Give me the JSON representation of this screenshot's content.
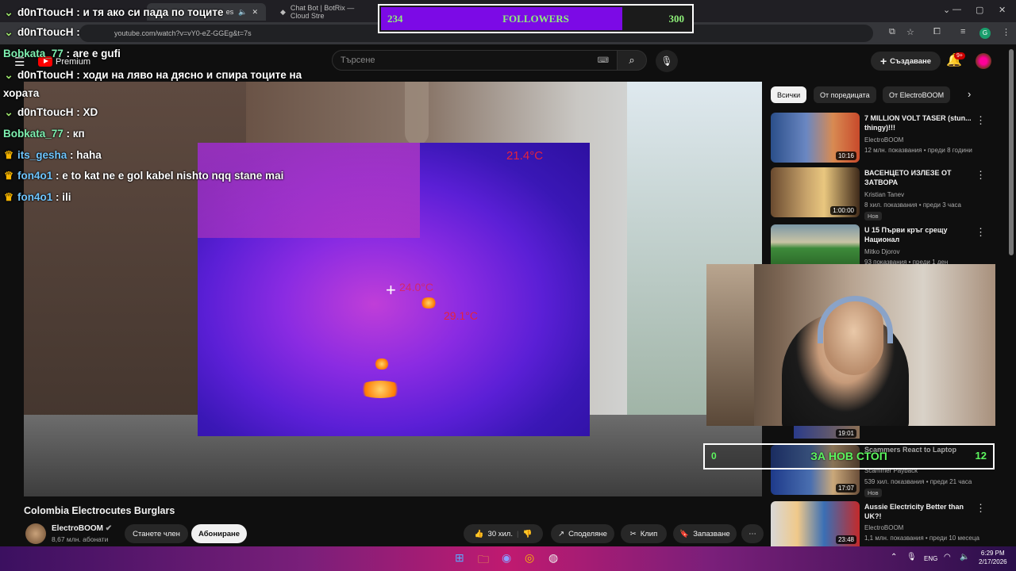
{
  "browser": {
    "tabs": [
      {
        "title": "… ×",
        "active": false
      },
      {
        "title": "es",
        "active": true
      },
      {
        "title": "Chat Bot | BotRix — Cloud Stre",
        "active": false
      }
    ],
    "url": "youtube.com/watch?v=vY0-eZ-GGEg&t=7s",
    "controls": {
      "minimize": "—",
      "maximize": "▢",
      "close": "✕"
    }
  },
  "youtube": {
    "logo_label": "Premium",
    "search_placeholder": "Търсене",
    "create_label": "Създаване",
    "notification_badge": "9+",
    "video": {
      "title": "Colombia Electrocutes Burglars",
      "thermal_readings": [
        "21.4°C",
        "24.0°C",
        "29.1°C"
      ]
    },
    "channel": {
      "name": "ElectroBOOM",
      "subscribers": "8,67 млн. абонати"
    },
    "actions": {
      "member": "Станете член",
      "subscribe": "Абониране",
      "likes": "30 хил.",
      "share": "Споделяне",
      "clip": "Клип",
      "save": "Запазване"
    },
    "chips": [
      "Всички",
      "От поредицата",
      "От ElectroBOOM"
    ],
    "recommendations": [
      {
        "title": "7 MILLION VOLT TASER (stun... thingy)!!!",
        "channel": "ElectroBOOM",
        "meta": "12 млн. показвания • преди 8 години",
        "duration": "10:16",
        "badge": ""
      },
      {
        "title": "ВАСЕНЦЕТО ИЗЛЕЗЕ ОТ ЗАТВОРА",
        "channel": "Kristian Tanev",
        "meta": "8 хил. показвания • преди 3 часа",
        "duration": "1:00:00",
        "badge": "Нов"
      },
      {
        "title": "U 15 Първи кръг срещу Национал",
        "channel": "Mitko Djorov",
        "meta": "93 показвания • преди 1 ден",
        "duration": "",
        "badge": ""
      },
      {
        "title": "Scammers React to Laptop",
        "channel": "Scammer Payback",
        "meta": "539 хил. показвания • преди 21 часа",
        "duration": "17:07",
        "badge": "Нов"
      },
      {
        "title": "Aussie Electricity Better than UK?!",
        "channel": "ElectroBOOM",
        "meta": "1,1 млн. показвания • преди 10 месеца",
        "duration": "23:48",
        "badge": ""
      }
    ],
    "hidden_duration": "19:01"
  },
  "overlay": {
    "followers": {
      "current": "234",
      "label": "FOLLOWERS",
      "goal": "300",
      "progress": 0.78
    },
    "stop_goal": {
      "current": "0",
      "label": "ЗА НОВ СТОП",
      "goal": "12"
    }
  },
  "chat": [
    {
      "user": "d0nTtoucH",
      "message": "и тя ако си пада по тоците",
      "badge": "chevron",
      "color": "#ffffff"
    },
    {
      "user": "d0nTtoucH",
      "message": "",
      "badge": "chevron",
      "color": "#ffffff"
    },
    {
      "user": "Bobkata_77",
      "message": "are e gufi",
      "badge": "",
      "color": "#7ef0b0"
    },
    {
      "user": "d0nTtoucH",
      "message": "ходи на ляво на дясно и спира тоците на",
      "badge": "chevron",
      "color": "#ffffff"
    },
    {
      "user": "",
      "message": "хората",
      "badge": "",
      "color": "#ffffff"
    },
    {
      "user": "d0nTtoucH",
      "message": "XD",
      "badge": "chevron",
      "color": "#ffffff"
    },
    {
      "user": "Bobkata_77",
      "message": "кп",
      "badge": "",
      "color": "#7ef0b0"
    },
    {
      "user": "its_gesha",
      "message": "haha",
      "badge": "crown",
      "color": "#6fc6ff"
    },
    {
      "user": "fon4o1",
      "message": "e to kat ne e gol kabel nishto nqq stane mai",
      "badge": "crown",
      "color": "#6fc6ff"
    },
    {
      "user": "fon4o1",
      "message": "ili",
      "badge": "crown",
      "color": "#6fc6ff"
    }
  ],
  "taskbar": {
    "lang": "ENG",
    "time": "6:29 PM",
    "date": "2/17/2026"
  }
}
